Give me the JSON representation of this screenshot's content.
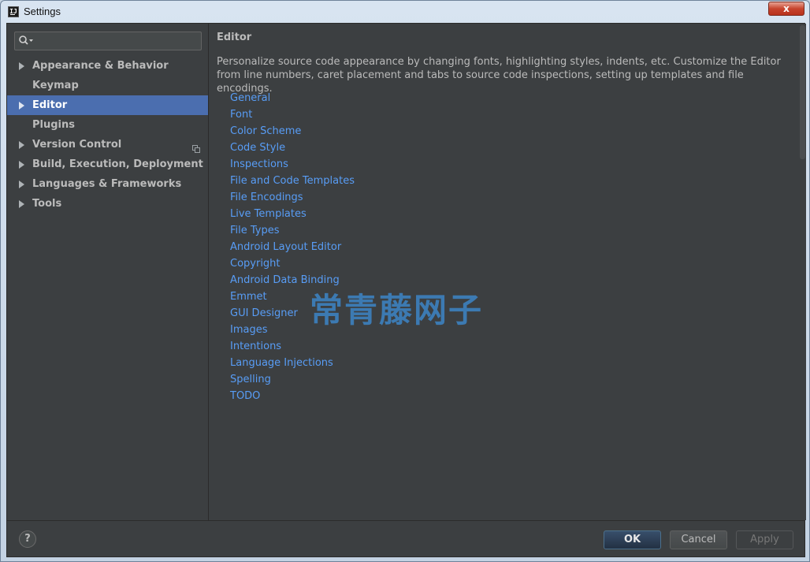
{
  "window": {
    "title": "Settings",
    "close_label": "x"
  },
  "sidebar": {
    "search": {
      "value": "",
      "placeholder": ""
    },
    "items": [
      {
        "label": "Appearance & Behavior",
        "expandable": true,
        "selected": false
      },
      {
        "label": "Keymap",
        "expandable": false,
        "selected": false
      },
      {
        "label": "Editor",
        "expandable": true,
        "selected": true
      },
      {
        "label": "Plugins",
        "expandable": false,
        "selected": false
      },
      {
        "label": "Version Control",
        "expandable": true,
        "selected": false,
        "badge_icon": "copy-icon"
      },
      {
        "label": "Build, Execution, Deployment",
        "expandable": true,
        "selected": false
      },
      {
        "label": "Languages & Frameworks",
        "expandable": true,
        "selected": false
      },
      {
        "label": "Tools",
        "expandable": true,
        "selected": false
      }
    ]
  },
  "main": {
    "title": "Editor",
    "description": "Personalize source code appearance by changing fonts, highlighting styles, indents, etc. Customize the Editor from line numbers, caret placement and tabs to source code inspections, setting up templates and file encodings.",
    "links": [
      "General",
      "Font",
      "Color Scheme",
      "Code Style",
      "Inspections",
      "File and Code Templates",
      "File Encodings",
      "Live Templates",
      "File Types",
      "Android Layout Editor",
      "Copyright",
      "Android Data Binding",
      "Emmet",
      "GUI Designer",
      "Images",
      "Intentions",
      "Language Injections",
      "Spelling",
      "TODO"
    ]
  },
  "watermark": "常青藤网子",
  "footer": {
    "help_label": "?",
    "ok_label": "OK",
    "cancel_label": "Cancel",
    "apply_label": "Apply"
  },
  "colors": {
    "background": "#3c3f41",
    "selection": "#4b6eaf",
    "link": "#589df6",
    "text": "#bbbbbb"
  }
}
